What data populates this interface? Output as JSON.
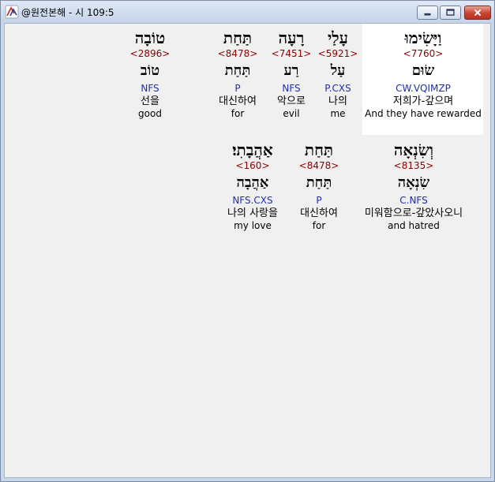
{
  "window": {
    "title": "@원전본해 - 시 109:5"
  },
  "rows": [
    {
      "words": [
        {
          "surface": "וַיָּשִׂימוּ",
          "strong": "<7760>",
          "lemma": "שׂוּם",
          "morph": "CW.VQIMZP",
          "korean": "저희가-갚으며",
          "english": "And they have rewarded",
          "highlighted": true
        },
        {
          "surface": "עָלַי",
          "strong": "<5921>",
          "lemma": "עַל",
          "morph": "P.CXS",
          "korean": "나의",
          "english": "me",
          "highlighted": false
        },
        {
          "surface": "רָעָה",
          "strong": "<7451>",
          "lemma": "רַע",
          "morph": "NFS",
          "korean": "악으로",
          "english": "evil",
          "highlighted": false
        },
        {
          "surface": "תַּחַת",
          "strong": "<8478>",
          "lemma": "תַּחַת",
          "morph": "P",
          "korean": "대신하여",
          "english": "for",
          "highlighted": false
        },
        {
          "surface": "טוֹבָה",
          "strong": "<2896>",
          "lemma": "טוֹב",
          "morph": "NFS",
          "korean": "선을",
          "english": "good",
          "highlighted": false
        }
      ]
    },
    {
      "words": [
        {
          "surface": "וְשִׂנְאָה",
          "strong": "<8135>",
          "lemma": "שִׂנְאָה",
          "morph": "C.NFS",
          "korean": "미워함으로-갚았사오니",
          "english": "and hatred",
          "highlighted": false
        },
        {
          "surface": "תַּחַת",
          "strong": "<8478>",
          "lemma": "תַּחַת",
          "morph": "P",
          "korean": "대신하여",
          "english": "for",
          "highlighted": false
        },
        {
          "surface": "אַהֲבָתִי׃",
          "strong": "<160>",
          "lemma": "אַהֲבָה",
          "morph": "NFS.CXS",
          "korean": "나의 사랑을",
          "english": "my love",
          "highlighted": false
        }
      ]
    }
  ]
}
